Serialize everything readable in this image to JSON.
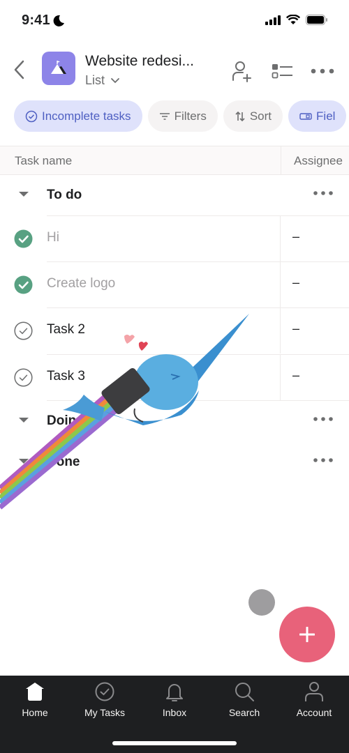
{
  "status_bar": {
    "time": "9:41"
  },
  "header": {
    "title": "Website redesi...",
    "view_label": "List",
    "icons": [
      "back-chevron-icon",
      "mountain-flag-icon",
      "add-member-icon",
      "customize-list-icon",
      "more-icon"
    ]
  },
  "chips": [
    {
      "label": "Incomplete tasks",
      "icon": "check-circle-icon",
      "active": true
    },
    {
      "label": "Filters",
      "icon": "filter-icon",
      "active": false
    },
    {
      "label": "Sort",
      "icon": "sort-icon",
      "active": false
    },
    {
      "label": "Fiel",
      "icon": "fields-icon",
      "active": true
    }
  ],
  "table": {
    "columns": [
      "Task name",
      "Assignee"
    ],
    "sections": [
      {
        "title": "To do",
        "tasks": [
          {
            "name": "Hi",
            "completed": true,
            "assignee": "–"
          },
          {
            "name": "Create logo",
            "completed": true,
            "assignee": "–"
          },
          {
            "name": "Task 2",
            "completed": false,
            "assignee": "–"
          },
          {
            "name": "Task 3",
            "completed": false,
            "assignee": "–"
          }
        ]
      },
      {
        "title": "Doing",
        "tasks": []
      },
      {
        "title": "Done",
        "tasks": []
      }
    ]
  },
  "fab": {
    "label": "+"
  },
  "tabbar": {
    "items": [
      {
        "label": "Home",
        "icon": "home-icon",
        "active": true
      },
      {
        "label": "My Tasks",
        "icon": "check-circle-icon",
        "active": false
      },
      {
        "label": "Inbox",
        "icon": "bell-icon",
        "active": false
      },
      {
        "label": "Search",
        "icon": "search-icon",
        "active": false
      },
      {
        "label": "Account",
        "icon": "account-icon",
        "active": false
      }
    ]
  },
  "colors": {
    "accent": "#4e5fc2",
    "chip_active_bg": "#dfe2fb",
    "project_icon": "#8d84e8",
    "completed_check": "#58a182",
    "fab": "#e8627a",
    "tabbar_bg": "#1e1f21"
  }
}
